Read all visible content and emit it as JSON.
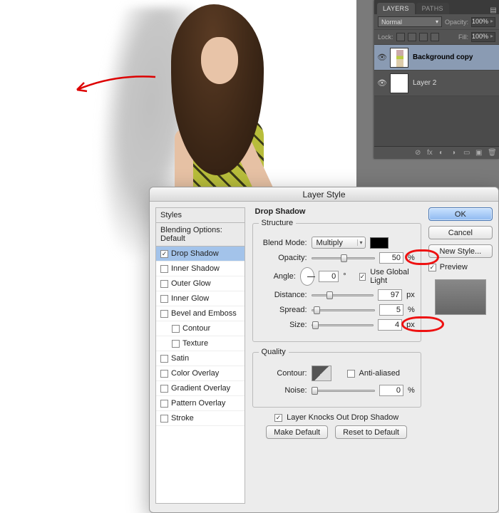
{
  "layers_panel": {
    "tabs": {
      "active": "LAYERS",
      "inactive": "PATHS"
    },
    "blend_mode": "Normal",
    "opacity_label": "Opacity:",
    "opacity_value": "100%",
    "lock_label": "Lock:",
    "fill_label": "Fill:",
    "fill_value": "100%",
    "layers": [
      {
        "name": "Background copy",
        "active": true
      },
      {
        "name": "Layer 2",
        "active": false
      }
    ]
  },
  "dialog": {
    "title": "Layer Style",
    "styles_header": "Styles",
    "blending_default": "Blending Options: Default",
    "items": [
      {
        "label": "Drop Shadow",
        "checked": true,
        "selected": true
      },
      {
        "label": "Inner Shadow",
        "checked": false
      },
      {
        "label": "Outer Glow",
        "checked": false
      },
      {
        "label": "Inner Glow",
        "checked": false
      },
      {
        "label": "Bevel and Emboss",
        "checked": false
      },
      {
        "label": "Contour",
        "checked": false,
        "sub": true
      },
      {
        "label": "Texture",
        "checked": false,
        "sub": true
      },
      {
        "label": "Satin",
        "checked": false
      },
      {
        "label": "Color Overlay",
        "checked": false
      },
      {
        "label": "Gradient Overlay",
        "checked": false
      },
      {
        "label": "Pattern Overlay",
        "checked": false
      },
      {
        "label": "Stroke",
        "checked": false
      }
    ],
    "section_title": "Drop Shadow",
    "structure_legend": "Structure",
    "blend_mode_label": "Blend Mode:",
    "blend_mode_value": "Multiply",
    "opacity_label": "Opacity:",
    "opacity_value": "50",
    "angle_label": "Angle:",
    "angle_value": "0",
    "angle_unit": "°",
    "global_light_label": "Use Global Light",
    "distance_label": "Distance:",
    "distance_value": "97",
    "spread_label": "Spread:",
    "spread_value": "5",
    "size_label": "Size:",
    "size_value": "4",
    "px": "px",
    "pct": "%",
    "quality_legend": "Quality",
    "contour_label": "Contour:",
    "antialias_label": "Anti-aliased",
    "noise_label": "Noise:",
    "noise_value": "0",
    "knocks_out_label": "Layer Knocks Out Drop Shadow",
    "make_default": "Make Default",
    "reset_default": "Reset to Default",
    "ok": "OK",
    "cancel": "Cancel",
    "new_style": "New Style...",
    "preview_label": "Preview"
  }
}
